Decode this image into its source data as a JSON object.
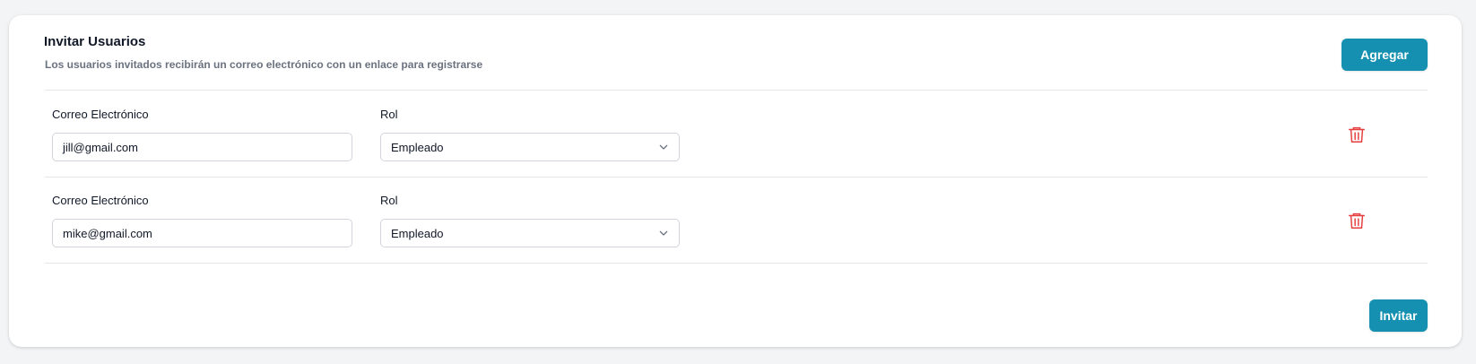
{
  "header": {
    "title": "Invitar Usuarios",
    "subtitle": "Los usuarios invitados recibirán un correo electrónico con un enlace para registrarse",
    "add_label": "Agregar"
  },
  "invites": [
    {
      "email_label": "Correo Electrónico",
      "email_value": "jill@gmail.com",
      "role_label": "Rol",
      "role_value": "Empleado",
      "delete_icon": "trash-icon"
    },
    {
      "email_label": "Correo Electrónico",
      "email_value": "mike@gmail.com",
      "role_label": "Rol",
      "role_value": "Empleado",
      "delete_icon": "trash-icon"
    }
  ],
  "footer": {
    "invite_label": "Invitar"
  },
  "colors": {
    "accent": "#1590b0",
    "danger": "#e53e3e"
  }
}
